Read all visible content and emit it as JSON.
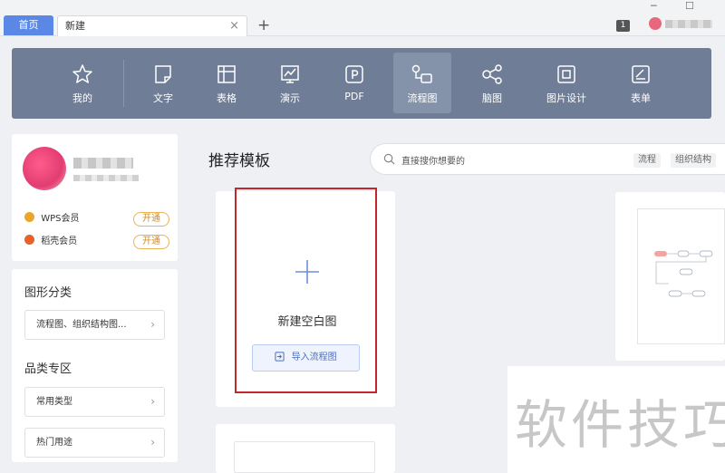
{
  "tabs": {
    "home_label": "首页",
    "active_label": "新建",
    "close_glyph": "×",
    "new_glyph": "+"
  },
  "titlebar": {
    "badge": "1",
    "minimize": "─",
    "maximize": "☐"
  },
  "toolbar": {
    "items": [
      {
        "label": "我的",
        "icon": "star-icon"
      },
      {
        "label": "文字",
        "icon": "document-icon"
      },
      {
        "label": "表格",
        "icon": "spreadsheet-icon"
      },
      {
        "label": "演示",
        "icon": "presentation-icon"
      },
      {
        "label": "PDF",
        "icon": "pdf-icon"
      },
      {
        "label": "流程图",
        "icon": "flowchart-icon",
        "active": true
      },
      {
        "label": "脑图",
        "icon": "mindmap-icon"
      },
      {
        "label": "图片设计",
        "icon": "image-design-icon"
      },
      {
        "label": "表单",
        "icon": "form-icon"
      }
    ]
  },
  "membership": {
    "wps": {
      "label": "WPS会员",
      "button": "开通",
      "color": "#e9a62b"
    },
    "docer": {
      "label": "稻壳会员",
      "button": "开通",
      "color": "#e8622a"
    }
  },
  "sidebar": {
    "shape_section_title": "图形分类",
    "shape_item": "流程图、组织结构图...",
    "category_section_title": "品类专区",
    "category_items": [
      "常用类型",
      "热门用途"
    ],
    "chevron": "›"
  },
  "main": {
    "heading": "推荐模板",
    "search_placeholder": "直接搜你想要的",
    "search_tags": [
      "流程",
      "组织结构"
    ],
    "new_blank_label": "新建空白图",
    "import_label": "导入流程图"
  },
  "watermark": "软件技巧",
  "colors": {
    "accent": "#5b87e6",
    "toolbar_bg": "#6f7d96",
    "highlight_frame": "#c4262e"
  }
}
